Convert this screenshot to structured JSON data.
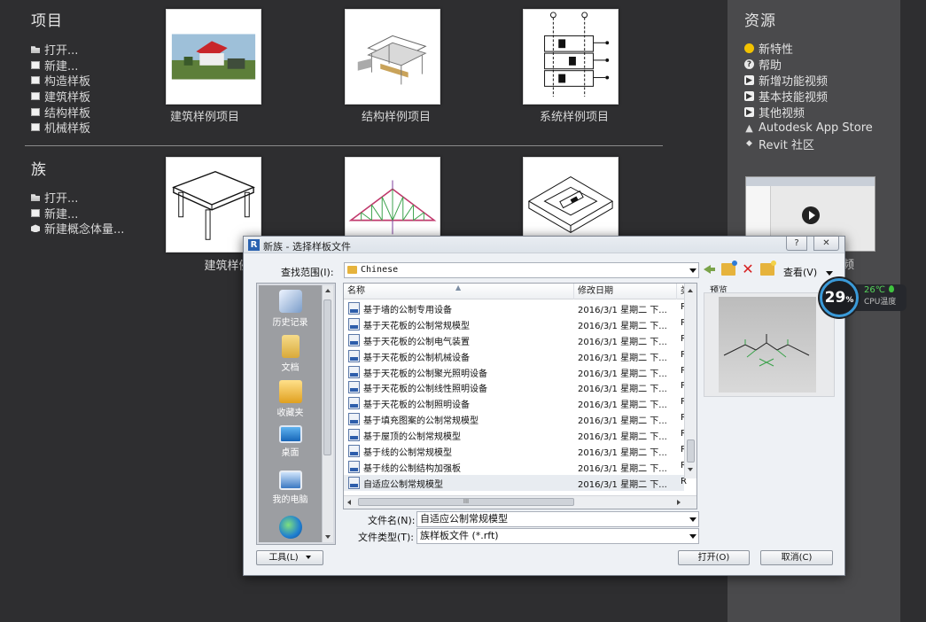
{
  "projects": {
    "title": "项目",
    "links": [
      {
        "icon": "open-folder-icon",
        "label": "打开..."
      },
      {
        "icon": "new-file-icon",
        "label": "新建..."
      },
      {
        "icon": "new-file-icon",
        "label": "构造样板"
      },
      {
        "icon": "new-file-icon",
        "label": "建筑样板"
      },
      {
        "icon": "new-file-icon",
        "label": "结构样板"
      },
      {
        "icon": "new-file-icon",
        "label": "机械样板"
      }
    ],
    "thumbnails": [
      {
        "label": "建筑样例项目",
        "image": "architectural-sample-image"
      },
      {
        "label": "结构样例项目",
        "image": "structural-sample-image"
      },
      {
        "label": "系统样例项目",
        "image": "systems-sample-image"
      }
    ]
  },
  "families": {
    "title": "族",
    "links": [
      {
        "icon": "open-folder-icon",
        "label": "打开..."
      },
      {
        "icon": "new-file-icon",
        "label": "新建..."
      },
      {
        "icon": "conceptual-mass-icon",
        "label": "新建概念体量..."
      }
    ],
    "thumbnails": [
      {
        "label": "建筑样例族",
        "image": "table-family-image"
      },
      {
        "label": "",
        "image": "truss-family-image"
      },
      {
        "label": "",
        "image": "mep-family-image"
      }
    ]
  },
  "resources": {
    "title": "资源",
    "links": [
      {
        "icon": "sun-icon",
        "label": "新特性"
      },
      {
        "icon": "help-icon",
        "label": "帮助"
      },
      {
        "icon": "video-icon",
        "label": "新增功能视频"
      },
      {
        "icon": "video-icon",
        "label": "基本技能视频"
      },
      {
        "icon": "video-icon",
        "label": "其他视频"
      },
      {
        "icon": "autodesk-icon",
        "label": "Autodesk App Store"
      },
      {
        "icon": "revit-icon",
        "label": "Revit 社区"
      }
    ],
    "video_trailing_text": "频"
  },
  "cpu_widget": {
    "percent": "29",
    "percent_unit": "%",
    "temperature": "26℃",
    "label": "CPU温度"
  },
  "dialog": {
    "app_icon": "R",
    "title": "新族 - 选择样板文件",
    "help_button": "?",
    "close_button": "✕",
    "lookin_label": "查找范围(I):",
    "lookin_value": "Chinese",
    "view_menu": "查看(V)",
    "places": [
      {
        "icon": "history-icon",
        "label": "历史记录"
      },
      {
        "icon": "documents-icon",
        "label": "文档"
      },
      {
        "icon": "favorites-icon",
        "label": "收藏夹"
      },
      {
        "icon": "desktop-icon",
        "label": "桌面"
      },
      {
        "icon": "my-computer-icon",
        "label": "我的电脑"
      },
      {
        "icon": "network-icon",
        "label": ""
      }
    ],
    "columns": {
      "name": "名称",
      "modified": "修改日期",
      "type": "类"
    },
    "files": [
      {
        "name": "基于墙的公制专用设备",
        "modified": "2016/3/1 星期二 下...",
        "type": "R"
      },
      {
        "name": "基于天花板的公制常规模型",
        "modified": "2016/3/1 星期二 下...",
        "type": "R"
      },
      {
        "name": "基于天花板的公制电气装置",
        "modified": "2016/3/1 星期二 下...",
        "type": "R"
      },
      {
        "name": "基于天花板的公制机械设备",
        "modified": "2016/3/1 星期二 下...",
        "type": "R"
      },
      {
        "name": "基于天花板的公制聚光照明设备",
        "modified": "2016/3/1 星期二 下...",
        "type": "R"
      },
      {
        "name": "基于天花板的公制线性照明设备",
        "modified": "2016/3/1 星期二 下...",
        "type": "R"
      },
      {
        "name": "基于天花板的公制照明设备",
        "modified": "2016/3/1 星期二 下...",
        "type": "R"
      },
      {
        "name": "基于填充图案的公制常规模型",
        "modified": "2016/3/1 星期二 下...",
        "type": "R"
      },
      {
        "name": "基于屋顶的公制常规模型",
        "modified": "2016/3/1 星期二 下...",
        "type": "R"
      },
      {
        "name": "基于线的公制常规模型",
        "modified": "2016/3/1 星期二 下...",
        "type": "R"
      },
      {
        "name": "基于线的公制结构加强板",
        "modified": "2016/3/1 星期二 下...",
        "type": "R"
      },
      {
        "name": "自适应公制常规模型",
        "modified": "2016/3/1 星期二 下...",
        "type": "R"
      }
    ],
    "selected_file_index": 11,
    "hscroll_grip": "III",
    "preview_label": "预览",
    "filename_label": "文件名(N):",
    "filename_value": "自适应公制常规模型",
    "filetype_label": "文件类型(T):",
    "filetype_value": "族样板文件 (*.rft)",
    "tools_button": "工具(L)",
    "open_button": "打开(O)",
    "cancel_button": "取消(C)"
  }
}
